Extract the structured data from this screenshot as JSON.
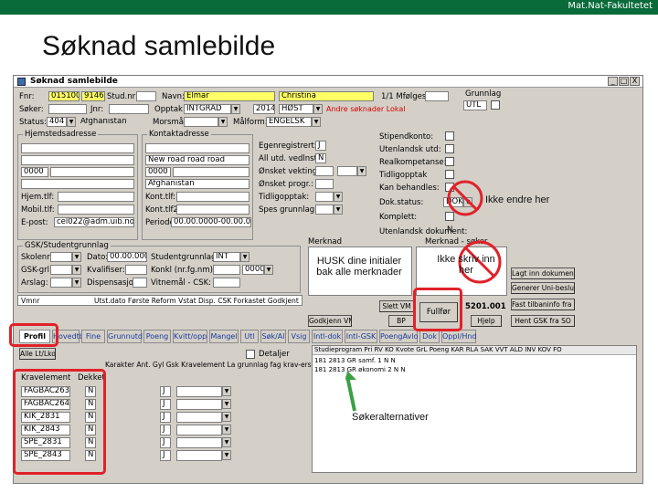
{
  "header": {
    "org": "Mat.Nat-Fakultetet",
    "slide_title": "Søknad samlebilde"
  },
  "window": {
    "title": "Søknad samlebilde",
    "buttons": [
      "_",
      "□",
      "X"
    ]
  },
  "top": {
    "fnr_label": "Fnr:",
    "fnr_value": "015100",
    "fnr_suffix": "91467",
    "studnr_label": "Stud.nr:",
    "navn_label": "Navn:",
    "navn_first": "Elmar",
    "navn_last": "Christina",
    "mfolges_label": "1/1 Mfølges:",
    "soker_label": "Søker:",
    "dato_label": "Jnr:",
    "opptak_label": "Opptak:",
    "opptak_value": "INTGRAD",
    "opptak_year": "2014",
    "opptak_term": "HØST",
    "andre_sok": "Andre søknader Lokal",
    "status_label": "Status:",
    "status_value": "404",
    "status_text": "Afghanistan",
    "morsmal_label": "Morsmål:",
    "malform_label": "Målform:",
    "malform_value": "ENGELSK",
    "grunnlag_label": "Grunnlag",
    "grunnlag_value": "UTL"
  },
  "address": {
    "hjem_title": "Hjemstedsadresse",
    "kontakt_title": "Kontaktadresse",
    "kontakt_street": "New road road road",
    "hjem_zip": "0000",
    "kontakt_zip": "0000",
    "kontakt_country": "Afghanistan",
    "hjem_tlf_label": "Hjem.tlf:",
    "mobil_tlf_label": "Mobil.tlf:",
    "epost_label": "E-post:",
    "epost_value": "cel022@adm.uib.no",
    "kont_tlf_label": "Kont.tlf:",
    "kont_tlf2_label": "Kont.tlf2:",
    "periode_label": "Periode",
    "periode_value": "00.00.0000-00.00.0000"
  },
  "middle": {
    "egenregistrert_label": "Egenregistrert:",
    "egenregistrert_value": "J",
    "all_utd_label": "All utd. vedlnst:",
    "all_utd_value": "N",
    "onsket_vekting_label": "Ønsket vekting:",
    "onsket_prog_label": "Ønsket progr.:",
    "tidligopptak_label": "Tidligopptak:",
    "spes_grunnlag_label": "Spes grunnlag:",
    "stipendkonto_label": "Stipendkonto:",
    "ikke_utd_label": "Utenlandsk utd:",
    "realkomp_label": "Realkompetanse:",
    "tidligopptak2_label": "Tidligopptak",
    "kan_behandles_label": "Kan behandles:",
    "dok_status_label": "Dok.status:",
    "dok_status_value": "DOK",
    "komplett_label": "Komplett:",
    "utenlandsk_label": "Utenlandsk dokument:",
    "utenlandsk_value": "N"
  },
  "gsk": {
    "title": "GSK/Studentgrunnlag",
    "skolenr_label": "Skolenr:",
    "dato_label": "Dato:",
    "dato_value": "00.00.0000",
    "gskgrl_label": "GSK-grl:",
    "kvalifiser_label": "Kvalifiser:",
    "arslag_label": "Arslag:",
    "dispensasjon_label": "Dispensasjon:",
    "studentgrunnlag_label": "Studentgrunnlag:",
    "studentgrunnlag_value": "INT",
    "konkl_label": "Konkl (nr.fg.nm):",
    "konkl_value": "0000",
    "vitnemal_label": "Vitnemål - CSK:",
    "vmnr_label": "Vmnr",
    "vmnr_headers": "Utst.dato Første Reform Vstat Disp. CSK Forkastet Godkjent"
  },
  "merknad": {
    "label": "Merknad",
    "label2": "Merknad - søker"
  },
  "right_buttons": {
    "lagt_inn": "Lagt inn dokument",
    "generer": "Generer Uni-beslutning",
    "fast_kvote": "Fast tilbaninfo fra SO",
    "hent_gsk": "Hent GSK fra SO",
    "slett_vm": "Slett VM",
    "gjenopprett": "Godkjenn VM",
    "bp": "BP",
    "fullfor": "Fullfør",
    "nr_value": "5201.001",
    "hjelp": "Hjelp"
  },
  "tabs": [
    "Profil",
    "Hovedtbl",
    "Fine",
    "Grunnutd",
    "Poeng",
    "Kvitt/opp",
    "Mangel",
    "Utl",
    "Søk/Al",
    "Vsig",
    "Intl-dok",
    "Intl-GSK",
    "PoengAvlo",
    "Dok",
    "Oppl/Hnd"
  ],
  "alternatives": {
    "alle_label": "Alle Lt/Lko",
    "detaljer_label": "Detaljer",
    "col_kravelement": "Kravelement",
    "col_dekket": "Dekket",
    "col_extra": "Karakter  Ant.  Gyl  Gsk Kravelement  La  grunnlag fag  krav-erstatning  grl  Merknad",
    "rows": [
      {
        "code": "FAGBAC2631",
        "val": "N",
        "j": "J"
      },
      {
        "code": "FAGBAC2640",
        "val": "N",
        "j": "J"
      },
      {
        "code": "KIK_2831",
        "val": "N",
        "j": "J"
      },
      {
        "code": "KIK_2843",
        "val": "N",
        "j": "J"
      },
      {
        "code": "SPE_2831",
        "val": "N",
        "j": "J"
      },
      {
        "code": "SPE_2843",
        "val": "N",
        "j": "J"
      }
    ],
    "table_header": "Studieprogram     Pri  RV  KO  Kvote      GrL  Poeng   KAR  RLA  SAK  VVT  ALD  INV  KOV  FO",
    "table_rows": [
      "181 2813   GR samf.     1   N   N",
      "181 2813   GR økonomi   2   N   N"
    ]
  },
  "annotations": {
    "ikke_endre": "Ikke endre her",
    "husk": "HUSK dine initialer bak alle merknader",
    "ikke_skriv": "Ikke skriv inn her",
    "soker_alt": "Søkeralternativer"
  },
  "colors": {
    "header_green": "#0a6b3a",
    "annotation_red": "#e0222a",
    "field_yellow": "#ffff66",
    "window_gray": "#d4d0c8"
  }
}
